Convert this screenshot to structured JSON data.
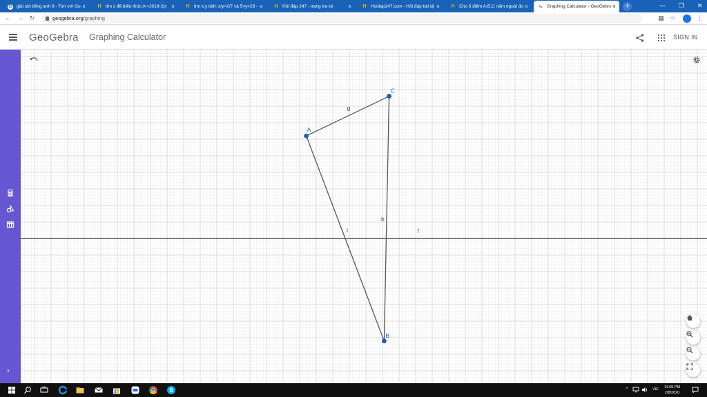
{
  "browser": {
    "tabs": [
      {
        "title": "giải sbt tiếng anh 8 - Tìm với Go",
        "favicon": "google-icon",
        "active": false
      },
      {
        "title": "tìm x để biểu thức A =2019-2|x",
        "favicon": "hoidap247-icon",
        "active": false
      },
      {
        "title": "tìm x,y biết: x/y=2/7 và 5<y<29 -",
        "favicon": "hoidap247-icon",
        "active": false
      },
      {
        "title": "Hỏi đáp 247 - trang tra loi",
        "favicon": "hoidap247-icon",
        "active": false
      },
      {
        "title": "Hoidap247.com - Hỏi đáp bài tậ",
        "favicon": "hoidap247-icon",
        "active": false
      },
      {
        "title": "Cho 3 điểm A,B,C nằm ngoài đư",
        "favicon": "hoidap247-icon",
        "active": false
      },
      {
        "title": "Graphing Calculator - GeoGebra",
        "favicon": "geogebra-icon",
        "active": true
      }
    ],
    "tab_close_glyph": "×",
    "new_tab_glyph": "+",
    "url_host": "geogebra.org",
    "url_path": "/graphing"
  },
  "app": {
    "logo": "GeoGebra",
    "title": "Graphing Calculator",
    "sign_in": "SIGN IN",
    "colors": {
      "accent": "#6557d2",
      "point": "#1565c0",
      "line": "#555555",
      "axis": "#333333"
    }
  },
  "construction": {
    "points": [
      {
        "name": "A",
        "x": -3.6,
        "y": 6.2
      },
      {
        "name": "B",
        "x": 1.1,
        "y": -6.2
      },
      {
        "name": "C",
        "x": 1.4,
        "y": 8.6
      }
    ],
    "segments": [
      {
        "name": "g",
        "from": "A",
        "to": "C"
      },
      {
        "name": "h",
        "from": "C",
        "to": "B"
      },
      {
        "name": "i",
        "from": "A",
        "to": "B"
      }
    ],
    "line": {
      "name": "f",
      "equation": "y = 0"
    }
  },
  "taskbar": {
    "time": "11:05 PM",
    "date": "2/8/2020",
    "language": "VIE"
  }
}
